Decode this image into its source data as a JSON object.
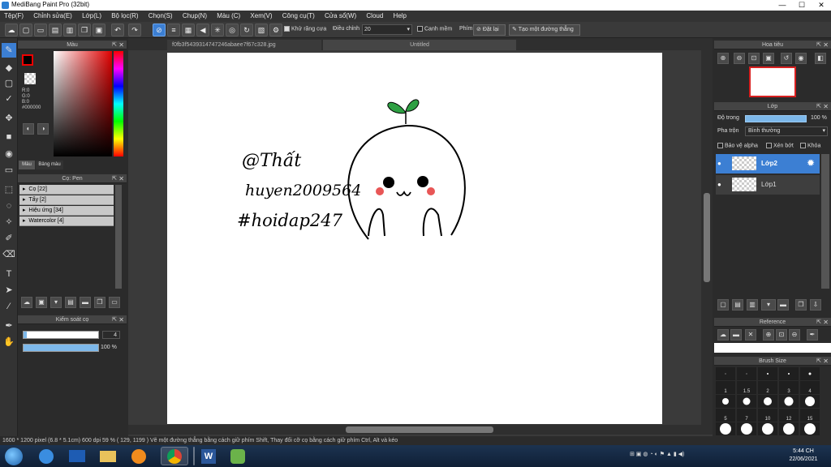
{
  "window": {
    "title": "MediBang Paint Pro (32bit)"
  },
  "menu": [
    "Tệp(F)",
    "Chỉnh sửa(E)",
    "Lớp(L)",
    "Bộ lọc(R)",
    "Chọn(S)",
    "Chụp(N)",
    "Màu (C)",
    "Xem(V)",
    "Công cụ(T)",
    "Cửa sổ(W)",
    "Cloud",
    "Help"
  ],
  "toolbar": {
    "antialias_label": "Khử răng cưa",
    "adjust_label": "Điều chỉnh",
    "adjust_value": "20",
    "smooth_label": "Canh mềm",
    "key_label": "Phím",
    "reset_label": "Đặt lại",
    "line_label": "Tạo một đường thẳng"
  },
  "tabs": [
    "f0fb3f5439314747246abaee7f67c328.jpg",
    "Untitled"
  ],
  "color_panel": {
    "title": "Màu",
    "r": "R:0",
    "g": "G:0",
    "b": "B:0",
    "hex": "#000000",
    "tab_color": "Màu",
    "tab_palette": "Bảng màu"
  },
  "brush_panel": {
    "title": "Cọ: Pen",
    "items": [
      "Cọ [22]",
      "Tẩy [2]",
      "Hiệu ứng [34]",
      "Watercolor [4]"
    ]
  },
  "brush_control": {
    "title": "Kiểm soát cọ",
    "size": "4",
    "opacity": "100 %",
    "size_fraction": 0.04,
    "opacity_fraction": 1.0
  },
  "navigator": {
    "title": "Hoa tiêu"
  },
  "layer_panel": {
    "title": "Lớp",
    "opacity_label": "Độ trong",
    "opacity_value": "100 %",
    "blend_label": "Pha trộn",
    "blend_value": "Bình thường",
    "protect_alpha": "Bảo vệ alpha",
    "clipping": "Xén bớt",
    "lock": "Khóa",
    "layers": [
      "Lớp2",
      "Lớp1"
    ]
  },
  "reference": {
    "title": "Reference"
  },
  "brush_size": {
    "title": "Brush Size",
    "labels": [
      "",
      "",
      "",
      "",
      "",
      "1",
      "1.5",
      "2",
      "3",
      "4",
      "",
      "",
      "",
      "",
      "",
      "5",
      "7",
      "10",
      "12",
      "15",
      "",
      "",
      "",
      "",
      ""
    ]
  },
  "drawing": {
    "line1": "@Thất",
    "line2": "huyen2009564",
    "line3": "#hoidap247"
  },
  "status": "1600 * 1200 pixel   (6.8 * 5.1cm)   600 dpi   59 %   ( 129, 1199 )   Vẽ một đường thẳng bằng cách giữ phím Shift, Thay đổi cỡ cọ bằng cách giữ phím Ctrl, Alt và kéo",
  "clock": {
    "time": "5:44 CH",
    "date": "22/06/2021"
  },
  "colors": {
    "accent": "#3c7fd3",
    "foreground": "#000000",
    "sprout": "#2ea043",
    "cheek": "#e85656"
  }
}
